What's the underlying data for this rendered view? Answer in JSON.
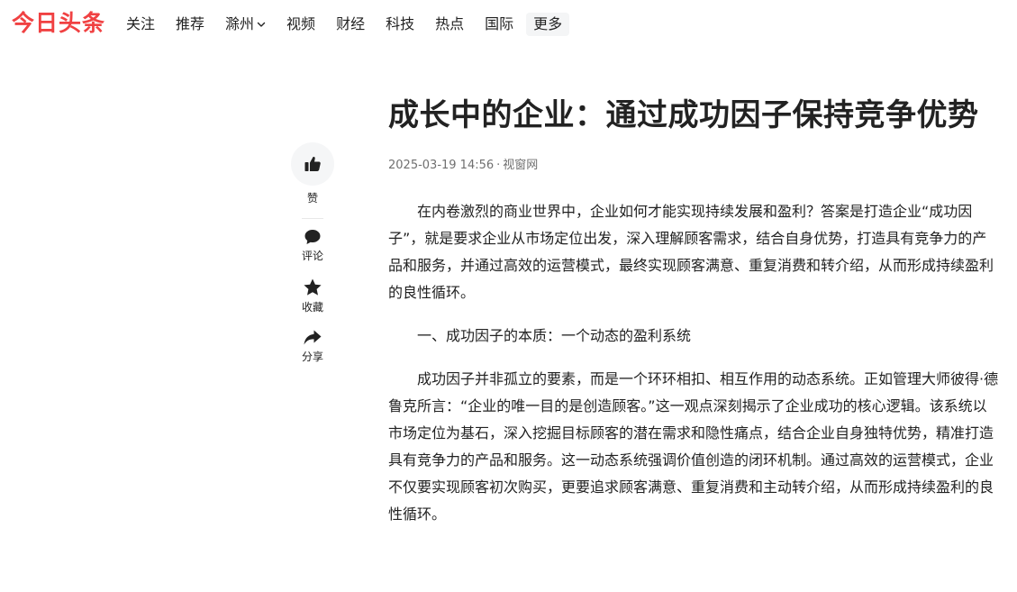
{
  "header": {
    "logo": "今日头条",
    "nav": [
      {
        "label": "关注"
      },
      {
        "label": "推荐"
      },
      {
        "label": "滁州",
        "dropdown": true
      },
      {
        "label": "视频"
      },
      {
        "label": "财经"
      },
      {
        "label": "科技"
      },
      {
        "label": "热点"
      },
      {
        "label": "国际"
      }
    ],
    "more_label": "更多",
    "brand_color": "#f04142"
  },
  "sidebar": {
    "like_label": "赞",
    "actions": [
      {
        "label": "评论",
        "icon": "comment-icon"
      },
      {
        "label": "收藏",
        "icon": "star-icon"
      },
      {
        "label": "分享",
        "icon": "share-icon"
      }
    ]
  },
  "article": {
    "title": "成长中的企业：通过成功因子保持竞争优势",
    "datetime": "2025-03-19 14:56",
    "source": "视窗网",
    "paragraphs": [
      "在内卷激烈的商业世界中，企业如何才能实现持续发展和盈利？答案是打造企业“成功因子”，就是要求企业从市场定位出发，深入理解顾客需求，结合自身优势，打造具有竞争力的产品和服务，并通过高效的运营模式，最终实现顾客满意、重复消费和转介绍，从而形成持续盈利的良性循环。",
      "一、成功因子的本质：一个动态的盈利系统",
      "成功因子并非孤立的要素，而是一个环环相扣、相互作用的动态系统。正如管理大师彼得·德鲁克所言：“企业的唯一目的是创造顾客。”这一观点深刻揭示了企业成功的核心逻辑。该系统以市场定位为基石，深入挖掘目标顾客的潜在需求和隐性痛点，结合企业自身独特优势，精准打造具有竞争力的产品和服务。这一动态系统强调价值创造的闭环机制。通过高效的运营模式，企业不仅要实现顾客初次购买，更要追求顾客满意、重复消费和主动转介绍，从而形成持续盈利的良性循环。"
    ]
  }
}
